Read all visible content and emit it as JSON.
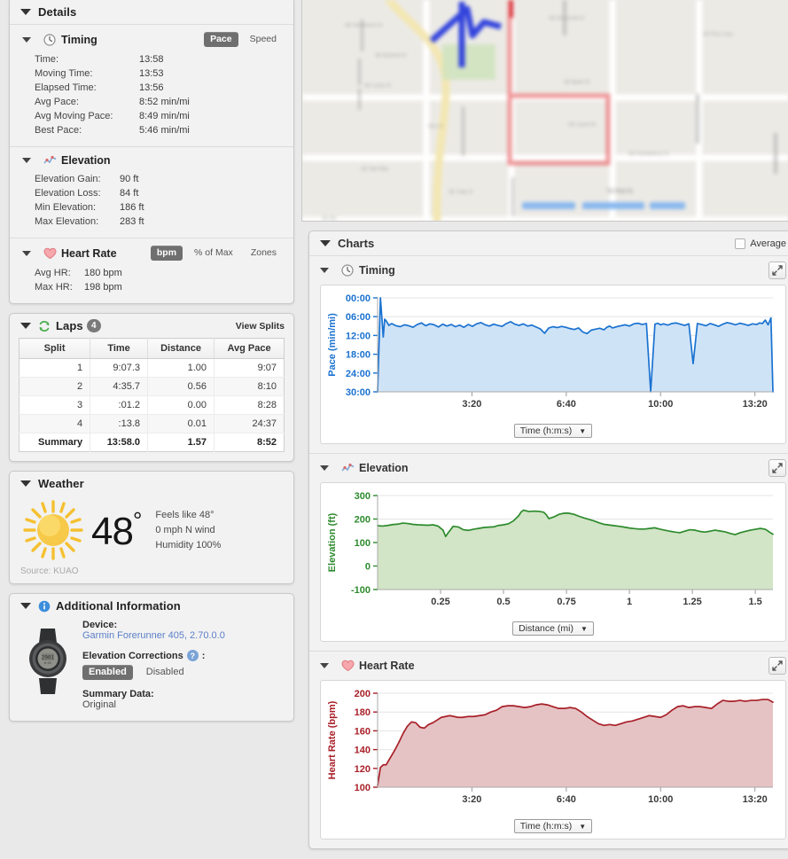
{
  "details": {
    "title": "Details",
    "timing": {
      "label": "Timing",
      "icon": "clock-icon",
      "toggles": [
        {
          "label": "Pace",
          "active": true
        },
        {
          "label": "Speed",
          "active": false
        }
      ],
      "rows": [
        {
          "key": "Time:",
          "value": "13:58"
        },
        {
          "key": "Moving Time:",
          "value": "13:53"
        },
        {
          "key": "Elapsed Time:",
          "value": "13:56"
        },
        {
          "key": "Avg Pace:",
          "value": "8:52 min/mi"
        },
        {
          "key": "Avg Moving Pace:",
          "value": "8:49 min/mi"
        },
        {
          "key": "Best Pace:",
          "value": "5:46 min/mi"
        }
      ]
    },
    "elevation": {
      "label": "Elevation",
      "icon": "elevation-chart-icon",
      "rows": [
        {
          "key": "Elevation Gain:",
          "value": "90 ft"
        },
        {
          "key": "Elevation Loss:",
          "value": "84 ft"
        },
        {
          "key": "Min Elevation:",
          "value": "186 ft"
        },
        {
          "key": "Max Elevation:",
          "value": "283 ft"
        }
      ]
    },
    "heart_rate": {
      "label": "Heart Rate",
      "icon": "heart-icon",
      "toggles": [
        {
          "label": "bpm",
          "active": true
        },
        {
          "label": "% of Max",
          "active": false
        },
        {
          "label": "Zones",
          "active": false
        }
      ],
      "rows": [
        {
          "key": "Avg HR:",
          "value": "180 bpm"
        },
        {
          "key": "Max HR:",
          "value": "198 bpm"
        }
      ]
    }
  },
  "laps": {
    "title": "Laps",
    "icon": "laps-icon",
    "count": "4",
    "view_splits_label": "View Splits",
    "columns": [
      "Split",
      "Time",
      "Distance",
      "Avg Pace"
    ],
    "rows": [
      [
        "1",
        "9:07.3",
        "1.00",
        "9:07"
      ],
      [
        "2",
        "4:35.7",
        "0.56",
        "8:10"
      ],
      [
        "3",
        ":01.2",
        "0.00",
        "8:28"
      ],
      [
        "4",
        ":13.8",
        "0.01",
        "24:37"
      ]
    ],
    "summary": [
      "Summary",
      "13:58.0",
      "1.57",
      "8:52"
    ]
  },
  "weather": {
    "title": "Weather",
    "icon": "sun-icon",
    "temperature": "48",
    "degree_symbol": "°",
    "feels_like": "Feels like 48°",
    "wind": "0 mph N wind",
    "humidity": "Humidity 100%",
    "source": "Source: KUAO"
  },
  "additional_information": {
    "title": "Additional Information",
    "icon": "info-icon",
    "device_label": "Device:",
    "device_value": "Garmin Forerunner 405, 2.70.0.0",
    "elevation_corrections_label": "Elevation Corrections",
    "help_icon_label": "?",
    "colon": ":",
    "corrections_toggles": [
      {
        "label": "Enabled",
        "active": true
      },
      {
        "label": "Disabled",
        "active": false
      }
    ],
    "summary_data_label": "Summary Data:",
    "summary_data_value": "Original"
  },
  "map": {
    "name": "activity-route-map",
    "route_color": "#e8565b",
    "marker_color": "#3344dd",
    "background_color": "#eceae5",
    "blurred": true
  },
  "charts": {
    "title": "Charts",
    "average_label": "Average",
    "average_checked": false,
    "expand_icon": "expand-icon",
    "sections": [
      {
        "label": "Timing",
        "icon": "clock-icon"
      },
      {
        "label": "Elevation",
        "icon": "elevation-chart-icon"
      },
      {
        "label": "Heart Rate",
        "icon": "heart-icon"
      }
    ]
  },
  "chart_data": [
    {
      "type": "area",
      "name": "pace-chart",
      "title": "Timing",
      "ylabel": "Pace (min/mi)",
      "xlabel": "Time (h:m:s)",
      "x_selector_label": "Time (h:m:s)",
      "color": "#1a72d0",
      "fill": "#cfe3f7",
      "y_inverted": true,
      "yticks": [
        "00:00",
        "06:00",
        "12:00",
        "18:00",
        "24:00",
        "30:00"
      ],
      "ylim": [
        0,
        30
      ],
      "xticks": [
        "3:20",
        "6:40",
        "10:00",
        "13:20"
      ],
      "xlim": [
        0,
        13.97
      ],
      "x": [
        0.0,
        0.1,
        0.2,
        0.25,
        0.3,
        0.4,
        0.5,
        0.65,
        0.8,
        0.95,
        1.1,
        1.25,
        1.4,
        1.55,
        1.7,
        1.85,
        2.0,
        2.15,
        2.3,
        2.45,
        2.6,
        2.75,
        2.9,
        3.05,
        3.2,
        3.35,
        3.5,
        3.65,
        3.8,
        3.95,
        4.1,
        4.25,
        4.4,
        4.55,
        4.7,
        4.85,
        5.0,
        5.15,
        5.3,
        5.45,
        5.6,
        5.75,
        5.9,
        6.05,
        6.2,
        6.35,
        6.5,
        6.65,
        6.8,
        6.95,
        7.1,
        7.25,
        7.4,
        7.55,
        7.7,
        7.85,
        8.0,
        8.1,
        8.2,
        8.3,
        8.45,
        8.6,
        8.75,
        8.9,
        9.05,
        9.2,
        9.35,
        9.5,
        9.65,
        9.8,
        9.9,
        10.0,
        10.1,
        10.25,
        10.4,
        10.55,
        10.7,
        10.85,
        11.0,
        11.15,
        11.3,
        11.45,
        11.6,
        11.75,
        11.9,
        12.05,
        12.2,
        12.35,
        12.5,
        12.65,
        12.8,
        12.95,
        13.1,
        13.25,
        13.4,
        13.5,
        13.6,
        13.7,
        13.8,
        13.9,
        13.97
      ],
      "y": [
        30.0,
        0.0,
        12.5,
        6.8,
        7.3,
        8.8,
        8.2,
        8.9,
        9.2,
        8.6,
        8.9,
        9.4,
        8.5,
        8.0,
        8.9,
        8.3,
        8.6,
        9.3,
        8.4,
        9.0,
        8.5,
        9.2,
        8.7,
        9.4,
        8.5,
        9.1,
        8.3,
        7.9,
        8.6,
        9.0,
        8.4,
        8.8,
        9.1,
        8.2,
        7.6,
        8.4,
        8.8,
        8.3,
        9.0,
        8.7,
        9.3,
        9.9,
        11.3,
        9.6,
        9.2,
        9.5,
        9.1,
        9.4,
        9.8,
        10.1,
        9.6,
        10.9,
        11.4,
        10.3,
        10.0,
        9.7,
        10.2,
        9.4,
        9.0,
        9.6,
        9.2,
        8.9,
        8.6,
        9.0,
        8.3,
        8.1,
        8.5,
        8.2,
        30.0,
        8.4,
        8.1,
        8.6,
        8.3,
        8.7,
        8.2,
        8.0,
        8.4,
        8.8,
        8.3,
        21.0,
        8.2,
        8.5,
        8.9,
        8.2,
        8.6,
        9.1,
        8.4,
        7.9,
        8.2,
        8.6,
        8.1,
        8.4,
        8.8,
        8.3,
        8.5,
        8.0,
        8.2,
        7.1,
        8.6,
        6.4,
        30.0
      ]
    },
    {
      "type": "area",
      "name": "elevation-chart",
      "title": "Elevation",
      "ylabel": "Elevation (ft)",
      "xlabel": "Distance (mi)",
      "x_selector_label": "Distance (mi)",
      "color": "#2d8a2d",
      "fill": "#d2e5c6",
      "yticks": [
        "300",
        "200",
        "100",
        "0",
        "-100"
      ],
      "ylim": [
        -100,
        340
      ],
      "xticks": [
        "0.25",
        "0.5",
        "0.75",
        "1",
        "1.25",
        "1.5"
      ],
      "xlim": [
        0,
        1.57
      ],
      "x": [
        0.0,
        0.02,
        0.04,
        0.06,
        0.08,
        0.1,
        0.12,
        0.14,
        0.16,
        0.18,
        0.2,
        0.22,
        0.24,
        0.26,
        0.27,
        0.28,
        0.3,
        0.32,
        0.34,
        0.36,
        0.38,
        0.4,
        0.42,
        0.44,
        0.46,
        0.48,
        0.5,
        0.52,
        0.54,
        0.56,
        0.57,
        0.58,
        0.6,
        0.62,
        0.64,
        0.66,
        0.67,
        0.68,
        0.7,
        0.72,
        0.74,
        0.75,
        0.76,
        0.78,
        0.8,
        0.82,
        0.84,
        0.86,
        0.88,
        0.9,
        0.92,
        0.94,
        0.96,
        0.98,
        1.0,
        1.02,
        1.04,
        1.06,
        1.08,
        1.1,
        1.12,
        1.14,
        1.16,
        1.18,
        1.2,
        1.22,
        1.24,
        1.26,
        1.28,
        1.3,
        1.32,
        1.34,
        1.36,
        1.38,
        1.4,
        1.42,
        1.44,
        1.46,
        1.48,
        1.5,
        1.52,
        1.54,
        1.56,
        1.57
      ],
      "y": [
        199,
        197,
        200,
        204,
        206,
        211,
        209,
        205,
        203,
        202,
        201,
        203,
        197,
        178,
        148,
        165,
        196,
        193,
        180,
        177,
        182,
        186,
        190,
        192,
        193,
        200,
        203,
        208,
        222,
        245,
        263,
        272,
        265,
        267,
        266,
        262,
        250,
        232,
        240,
        252,
        257,
        258,
        257,
        252,
        243,
        235,
        228,
        221,
        212,
        205,
        202,
        199,
        196,
        192,
        188,
        185,
        183,
        183,
        186,
        189,
        183,
        178,
        173,
        169,
        166,
        173,
        180,
        178,
        172,
        169,
        173,
        178,
        174,
        170,
        163,
        157,
        166,
        172,
        178,
        182,
        186,
        182,
        166,
        159
      ]
    },
    {
      "type": "area",
      "name": "heart-rate-chart",
      "title": "Heart Rate",
      "ylabel": "Heart Rate (bpm)",
      "xlabel": "Time (h:m:s)",
      "x_selector_label": "Time (h:m:s)",
      "color": "#a81f28",
      "fill": "#e5c3c5",
      "yticks": [
        "200",
        "180",
        "160",
        "140",
        "120",
        "100"
      ],
      "ylim": [
        100,
        205
      ],
      "xticks": [
        "3:20",
        "6:40",
        "10:00",
        "13:20"
      ],
      "xlim": [
        0,
        13.97
      ],
      "x": [
        0.0,
        0.1,
        0.2,
        0.3,
        0.45,
        0.6,
        0.75,
        0.9,
        1.05,
        1.2,
        1.35,
        1.5,
        1.65,
        1.8,
        1.95,
        2.1,
        2.25,
        2.4,
        2.55,
        2.7,
        2.85,
        3.0,
        3.2,
        3.4,
        3.6,
        3.8,
        4.0,
        4.2,
        4.4,
        4.6,
        4.8,
        5.0,
        5.2,
        5.4,
        5.6,
        5.8,
        6.0,
        6.2,
        6.4,
        6.6,
        6.8,
        7.0,
        7.2,
        7.4,
        7.6,
        7.8,
        8.0,
        8.2,
        8.4,
        8.6,
        8.8,
        9.0,
        9.2,
        9.4,
        9.6,
        9.8,
        10.0,
        10.2,
        10.4,
        10.6,
        10.8,
        11.0,
        11.2,
        11.4,
        11.6,
        11.8,
        12.0,
        12.2,
        12.4,
        12.6,
        12.8,
        13.0,
        13.2,
        13.4,
        13.6,
        13.8,
        13.97
      ],
      "y": [
        102,
        122,
        125,
        125,
        133,
        141,
        150,
        160,
        168,
        173,
        172,
        167,
        166,
        170,
        172,
        175,
        178,
        179,
        180,
        179,
        178,
        178,
        179,
        179,
        180,
        181,
        184,
        186,
        190,
        191,
        191,
        190,
        189,
        190,
        192,
        193,
        192,
        190,
        188,
        188,
        189,
        188,
        184,
        179,
        175,
        171,
        169,
        170,
        169,
        171,
        173,
        174,
        176,
        178,
        180,
        179,
        178,
        181,
        186,
        190,
        191,
        189,
        190,
        190,
        189,
        188,
        193,
        197,
        196,
        196,
        197,
        196,
        197,
        197,
        198,
        198,
        195
      ]
    }
  ]
}
